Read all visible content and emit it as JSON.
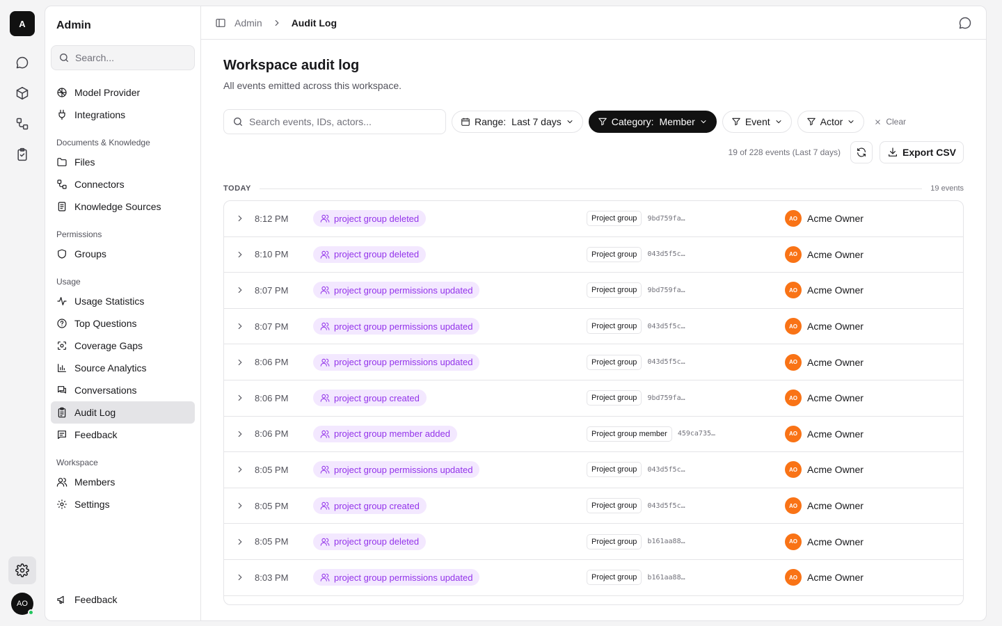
{
  "rail": {
    "logo": "A",
    "avatar": "AO"
  },
  "sidebar": {
    "title": "Admin",
    "search_placeholder": "Search...",
    "top_items": [
      {
        "label": "Model Provider"
      },
      {
        "label": "Integrations"
      }
    ],
    "sections": [
      {
        "title": "Documents & Knowledge",
        "items": [
          "Files",
          "Connectors",
          "Knowledge Sources"
        ]
      },
      {
        "title": "Permissions",
        "items": [
          "Groups"
        ]
      },
      {
        "title": "Usage",
        "items": [
          "Usage Statistics",
          "Top Questions",
          "Coverage Gaps",
          "Source Analytics",
          "Conversations",
          "Audit Log",
          "Feedback"
        ]
      },
      {
        "title": "Workspace",
        "items": [
          "Members",
          "Settings"
        ]
      }
    ],
    "active_item": "Audit Log",
    "footer_feedback": "Feedback"
  },
  "breadcrumb": {
    "parent": "Admin",
    "current": "Audit Log"
  },
  "page": {
    "title": "Workspace audit log",
    "subtitle": "All events emitted across this workspace."
  },
  "filters": {
    "search_placeholder": "Search events, IDs, actors...",
    "range_label": "Range:",
    "range_value": "Last 7 days",
    "category_label": "Category:",
    "category_value": "Member",
    "event_label": "Event",
    "actor_label": "Actor",
    "clear_label": "Clear"
  },
  "summary": {
    "count_text": "19 of 228 events (Last 7 days)",
    "export_label": "Export CSV"
  },
  "group": {
    "label": "TODAY",
    "count": "19 events"
  },
  "events": [
    {
      "time": "8:12 PM",
      "event": "project group deleted",
      "target": "Project group",
      "id": "9bd759fa…",
      "actor": "Acme Owner",
      "initials": "AO"
    },
    {
      "time": "8:10 PM",
      "event": "project group deleted",
      "target": "Project group",
      "id": "043d5f5c…",
      "actor": "Acme Owner",
      "initials": "AO"
    },
    {
      "time": "8:07 PM",
      "event": "project group permissions updated",
      "target": "Project group",
      "id": "9bd759fa…",
      "actor": "Acme Owner",
      "initials": "AO"
    },
    {
      "time": "8:07 PM",
      "event": "project group permissions updated",
      "target": "Project group",
      "id": "043d5f5c…",
      "actor": "Acme Owner",
      "initials": "AO"
    },
    {
      "time": "8:06 PM",
      "event": "project group permissions updated",
      "target": "Project group",
      "id": "043d5f5c…",
      "actor": "Acme Owner",
      "initials": "AO"
    },
    {
      "time": "8:06 PM",
      "event": "project group created",
      "target": "Project group",
      "id": "9bd759fa…",
      "actor": "Acme Owner",
      "initials": "AO"
    },
    {
      "time": "8:06 PM",
      "event": "project group member added",
      "target": "Project group member",
      "id": "459ca735…",
      "actor": "Acme Owner",
      "initials": "AO"
    },
    {
      "time": "8:05 PM",
      "event": "project group permissions updated",
      "target": "Project group",
      "id": "043d5f5c…",
      "actor": "Acme Owner",
      "initials": "AO"
    },
    {
      "time": "8:05 PM",
      "event": "project group created",
      "target": "Project group",
      "id": "043d5f5c…",
      "actor": "Acme Owner",
      "initials": "AO"
    },
    {
      "time": "8:05 PM",
      "event": "project group deleted",
      "target": "Project group",
      "id": "b161aa88…",
      "actor": "Acme Owner",
      "initials": "AO"
    },
    {
      "time": "8:03 PM",
      "event": "project group permissions updated",
      "target": "Project group",
      "id": "b161aa88…",
      "actor": "Acme Owner",
      "initials": "AO"
    }
  ],
  "colors": {
    "tag_bg": "#f3e8ff",
    "tag_text": "#9333ea",
    "avatar": "#f97316",
    "active_bg": "#e4e4e7"
  }
}
